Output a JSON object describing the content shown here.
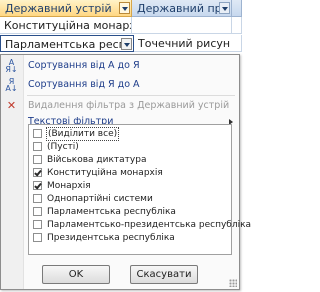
{
  "table": {
    "headers": [
      {
        "label": "Державний устрій"
      },
      {
        "label": "Державний пра"
      },
      {
        "label": ""
      }
    ],
    "row1": [
      "Конституційна монархія",
      "",
      ""
    ],
    "row2": [
      "Парламентська республ",
      "Точечний рисун"
    ]
  },
  "menu": {
    "sort_asc": "Сортування від А до Я",
    "sort_desc": "Сортування від Я до А",
    "clear_filter": "Видалення фільтра з Державний устрій",
    "text_filters": "Текстові фільтри",
    "items": [
      {
        "label": "(Виділити все)",
        "checked": false
      },
      {
        "label": "(Пусті)",
        "checked": false
      },
      {
        "label": "Військова диктатура",
        "checked": false
      },
      {
        "label": "Конституційна монархія",
        "checked": true
      },
      {
        "label": "Монархія",
        "checked": true
      },
      {
        "label": "Однопартійні системи",
        "checked": false
      },
      {
        "label": "Парламентська республіка",
        "checked": false
      },
      {
        "label": "Парламентсько-президентська республіка",
        "checked": false
      },
      {
        "label": "Президентська республіка",
        "checked": false
      }
    ],
    "ok": "OK",
    "cancel": "Скасувати"
  }
}
